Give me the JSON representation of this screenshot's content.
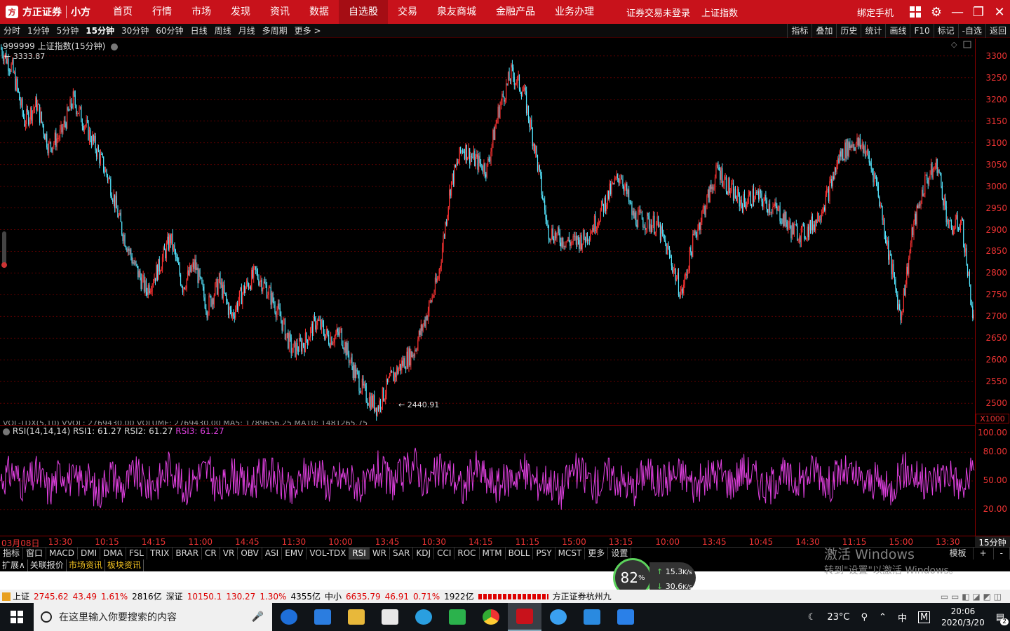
{
  "topbar": {
    "logo_text": "方正证券",
    "logo_sub": "小方",
    "nav": [
      "首页",
      "行情",
      "市场",
      "发现",
      "资讯",
      "数据",
      "自选股",
      "交易",
      "泉友商城",
      "金融产品",
      "业务办理"
    ],
    "active_nav": "自选股",
    "login_status": "证券交易未登录",
    "index_name": "上证指数",
    "bind_phone": "绑定手机"
  },
  "periodbar": {
    "periods": [
      "分时",
      "1分钟",
      "5分钟",
      "15分钟",
      "30分钟",
      "60分钟",
      "日线",
      "周线",
      "月线",
      "多周期",
      "更多 >"
    ],
    "active_period": "15分钟",
    "tools": [
      "指标",
      "叠加",
      "历史",
      "统计",
      "画线",
      "F10",
      "标记",
      "-自选",
      "返回"
    ]
  },
  "main_chart": {
    "title": "999999 上证指数(15分钟)",
    "high_label": "3333.87",
    "low_label": "2440.91",
    "y_ticks": [
      "3300",
      "3250",
      "3200",
      "3150",
      "3100",
      "3050",
      "3000",
      "2950",
      "2900",
      "2850",
      "2800",
      "2750",
      "2700",
      "2650",
      "2600",
      "2550",
      "2500"
    ],
    "x1000": "X1000"
  },
  "volume_line": "VOL-TDX(5,10) VVOL: 2769430.00  VOLUME: 2769430.00  MA5: 1789656.25  MA10: 1481265.75",
  "rsi": {
    "title": "RSI(14,14,14)",
    "rsi1": "RSI1: 61.27",
    "rsi2": "RSI2: 61.27",
    "rsi3": "RSI3: 61.27",
    "y_ticks": [
      "100.00",
      "80.00",
      "50.00",
      "20.00"
    ]
  },
  "time_axis": [
    "03月08日",
    "13:30",
    "10:15",
    "14:15",
    "11:00",
    "14:45",
    "11:30",
    "10:00",
    "13:45",
    "10:30",
    "14:15",
    "11:15",
    "15:00",
    "13:15",
    "10:00",
    "13:45",
    "10:45",
    "14:30",
    "11:15",
    "15:00",
    "13:30"
  ],
  "period_label": "15分钟",
  "indicators": [
    "指标",
    "窗口",
    "MACD",
    "DMI",
    "DMA",
    "FSL",
    "TRIX",
    "BRAR",
    "CR",
    "VR",
    "OBV",
    "ASI",
    "EMV",
    "VOL-TDX",
    "RSI",
    "WR",
    "SAR",
    "KDJ",
    "CCI",
    "ROC",
    "MTM",
    "BOLL",
    "PSY",
    "MCST",
    "更多",
    "设置"
  ],
  "active_indicator": "RSI",
  "indicator_right": [
    "模板",
    "+",
    "-"
  ],
  "subtabs": [
    "扩展∧",
    "关联报价",
    "市场资讯",
    "板块资讯"
  ],
  "watermark": {
    "line1": "激活 Windows",
    "line2": "转到\"设置\"以激活 Windows。"
  },
  "speed": {
    "percent": "82",
    "unit": "%",
    "up": "15.3",
    "up_unit": "K/s",
    "down": "30.6",
    "down_unit": "K/s"
  },
  "statusbar": {
    "sh_name": "上证",
    "sh_price": "2745.62",
    "sh_change": "43.49",
    "sh_pct": "1.61%",
    "sh_amount": "2816亿",
    "sz_name": "深证",
    "sz_price": "10150.1",
    "sz_change": "130.27",
    "sz_pct": "1.30%",
    "sz_amount": "4355亿",
    "zx_name": "中小",
    "zx_price": "6635.79",
    "zx_change": "46.91",
    "zx_pct": "0.71%",
    "zx_amount": "1922亿",
    "broker": "方正证券杭州九"
  },
  "taskbar": {
    "search_placeholder": "在这里输入你要搜索的内容",
    "temperature": "23°C",
    "ime": "中",
    "time": "20:06",
    "date": "2020/3/20",
    "notification_count": "2"
  },
  "colors": {
    "up": "#ff3333",
    "down": "#55e6ff",
    "rsi": "#e040e0",
    "brand_red": "#c8121b"
  },
  "chart_data": {
    "type": "line",
    "title": "999999 上证指数(15分钟)",
    "ylim": [
      2460,
      3340
    ],
    "series": [
      {
        "name": "上证指数",
        "values": [
          3320,
          3270,
          3150,
          3190,
          3090,
          3120,
          3200,
          3140,
          3080,
          3010,
          2900,
          2820,
          2760,
          2810,
          2880,
          2770,
          2820,
          2720,
          2780,
          2700,
          2760,
          2800,
          2760,
          2700,
          2620,
          2640,
          2690,
          2650,
          2660,
          2580,
          2520,
          2490,
          2550,
          2590,
          2620,
          2700,
          2790,
          3000,
          3090,
          3060,
          3040,
          3180,
          3260,
          3220,
          3080,
          2900,
          2880,
          2870,
          2880,
          2920,
          2980,
          3030,
          2930,
          2920,
          2910,
          2840,
          2750,
          2880,
          2960,
          3040,
          2990,
          2960,
          2980,
          2960,
          2940,
          2900,
          2890,
          2920,
          2980,
          3070,
          3100,
          3090,
          3010,
          2850,
          2700,
          2900,
          3010,
          3050,
          2900,
          2920,
          2690
        ]
      },
      {
        "name": "RSI",
        "values": [
          52,
          60,
          45,
          58,
          40,
          62,
          48,
          55,
          35,
          60,
          42,
          58,
          45,
          50,
          68,
          40,
          55,
          62,
          38,
          58,
          45,
          52,
          60,
          48,
          35,
          58,
          62,
          45,
          55,
          50,
          40,
          62,
          48,
          55,
          70,
          45,
          60,
          58,
          40,
          65,
          50,
          45,
          55,
          60,
          48,
          52,
          38,
          62,
          55,
          45,
          58,
          50,
          42,
          62,
          48,
          55,
          58,
          45,
          52,
          60,
          48,
          62,
          55,
          40,
          58,
          50,
          52,
          65,
          45,
          60,
          55,
          48,
          50,
          38,
          62,
          58,
          45,
          55,
          60,
          40,
          61.27
        ]
      }
    ]
  }
}
